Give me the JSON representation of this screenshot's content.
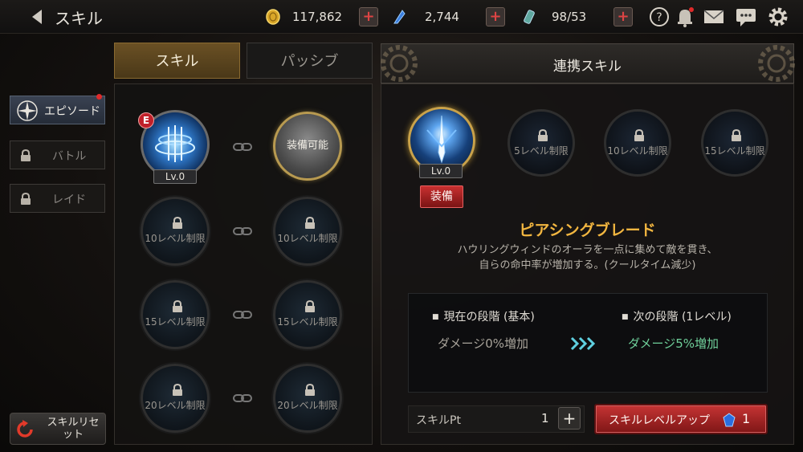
{
  "header": {
    "title": "スキル",
    "gold": "117,862",
    "crystal": "2,744",
    "potion": "98/53"
  },
  "sidebar": {
    "tabs": [
      {
        "label": "エピソード",
        "state": "active"
      },
      {
        "label": "バトル",
        "state": "locked"
      },
      {
        "label": "レイド",
        "state": "locked"
      }
    ],
    "reset_label": "スキルリセット"
  },
  "middle": {
    "tabs": [
      "スキル",
      "パッシブ"
    ],
    "badge": "E",
    "slots": [
      {
        "type": "skill",
        "level": "Lv.0"
      },
      {
        "type": "equip",
        "label": "装備可能"
      },
      {
        "type": "locked",
        "label": "10レベル制限"
      },
      {
        "type": "locked",
        "label": "10レベル制限"
      },
      {
        "type": "locked",
        "label": "15レベル制限"
      },
      {
        "type": "locked",
        "label": "15レベル制限"
      },
      {
        "type": "locked",
        "label": "20レベル制限"
      },
      {
        "type": "locked",
        "label": "20レベル制限"
      }
    ]
  },
  "right": {
    "title": "連携スキル",
    "slots": [
      {
        "type": "selected",
        "level": "Lv.0"
      },
      {
        "type": "locked",
        "label": "5レベル制限"
      },
      {
        "type": "locked",
        "label": "10レベル制限"
      },
      {
        "type": "locked",
        "label": "15レベル制限"
      }
    ],
    "equip_label": "装備",
    "skill_name": "ピアシングブレード",
    "desc_line1": "ハウリングウィンドのオーラを一点に集めて敵を貫き、",
    "desc_line2": "自らの命中率が増加する。(クールタイム減少)",
    "current_stage": "現在の段階 (基本)",
    "current_value": "ダメージ0%増加",
    "next_stage": "次の段階 (1レベル)",
    "next_value": "ダメージ5%増加",
    "skill_pt_label": "スキルPt",
    "skill_pt_value": "1",
    "levelup_label": "スキルレベルアップ",
    "levelup_cost": "1"
  },
  "colors": {
    "accent_gold": "#f2b640",
    "next_value": "#6fcf9a",
    "button_red": "#c63434"
  }
}
